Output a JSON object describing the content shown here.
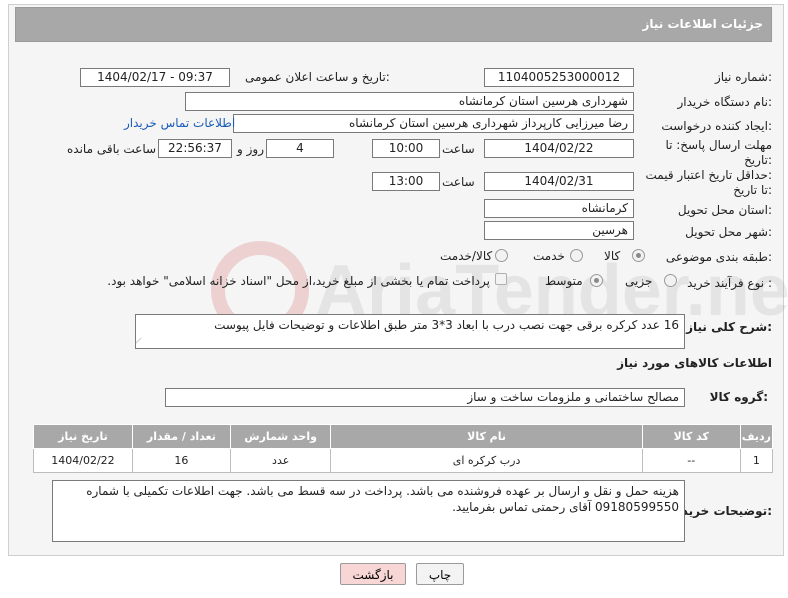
{
  "header": {
    "title": "جزئیات اطلاعات نیاز"
  },
  "fields": {
    "need_number_label": "شماره نیاز:",
    "need_number": "1104005253000012",
    "announce_label": "تاریخ و ساعت اعلان عمومی:",
    "announce_value": "1404/02/17 - 09:37",
    "buyer_org_label": "نام دستگاه خریدار:",
    "buyer_org": "شهرداری هرسین استان کرمانشاه",
    "creator_label": "ایجاد کننده درخواست:",
    "creator": "رضا میرزایی کارپرداز شهرداری هرسین استان کرمانشاه",
    "buyer_contact_link": "اطلاعات تماس خریدار",
    "reply_deadline_label_1": "مهلت ارسال پاسخ: تا",
    "reply_deadline_label_2": "تاریخ:",
    "reply_date": "1404/02/22",
    "time_label": "ساعت",
    "reply_time": "10:00",
    "days_value": "4",
    "days_label": "روز و",
    "remaining_time": "22:56:37",
    "remaining_label": "ساعت باقی مانده",
    "price_validity_label_1": "حداقل تاریخ اعتبار قیمت:",
    "price_validity_label_2": "تا تاریخ:",
    "price_date": "1404/02/31",
    "price_time": "13:00",
    "province_label": "استان محل تحویل:",
    "province": "کرمانشاه",
    "city_label": "شهر محل تحویل:",
    "city": "هرسین",
    "category_label": "طبقه بندی موضوعی:",
    "category_options": [
      "کالا",
      "خدمت",
      "کالا/خدمت"
    ],
    "process_label": "نوع فرآیند خرید :",
    "process_options": [
      "جزیی",
      "متوسط"
    ],
    "payment_note": "پرداخت تمام یا بخشی از مبلغ خرید،از محل \"اسناد خزانه اسلامی\" خواهد بود.",
    "description_label": "شرح کلی نیاز:",
    "description": "16 عدد کرکره برقی جهت نصب درب با ابعاد 3*3 متر طبق اطلاعات و توضیحات فایل پیوست",
    "items_section_label": "اطلاعات کالاهای مورد نیاز",
    "goods_group_label": "گروه کالا:",
    "goods_group": "مصالح ساختمانی و ملزومات ساخت و ساز",
    "buyer_notes_label": "توضیحات خریدار:",
    "buyer_notes": "هزینه حمل و نقل و ارسال بر عهده فروشنده می باشد. پرداخت در سه قسط می باشد. جهت اطلاعات تکمیلی با شماره 09180599550 آقای رحمتی تماس بفرمایید."
  },
  "table": {
    "headers": [
      "ردیف",
      "کد کالا",
      "نام کالا",
      "واحد شمارش",
      "تعداد / مقدار",
      "تاریخ نیاز"
    ],
    "rows": [
      [
        "1",
        "--",
        "درب کرکره ای",
        "عدد",
        "16",
        "1404/02/22"
      ]
    ]
  },
  "buttons": {
    "print": "چاپ",
    "back": "بازگشت"
  },
  "watermark": {
    "text": "AriaTender.net"
  },
  "colors": {
    "header_bg": "#a8a8a8",
    "link": "#1a5bb8",
    "back_button_bg": "#f9d6d6"
  }
}
